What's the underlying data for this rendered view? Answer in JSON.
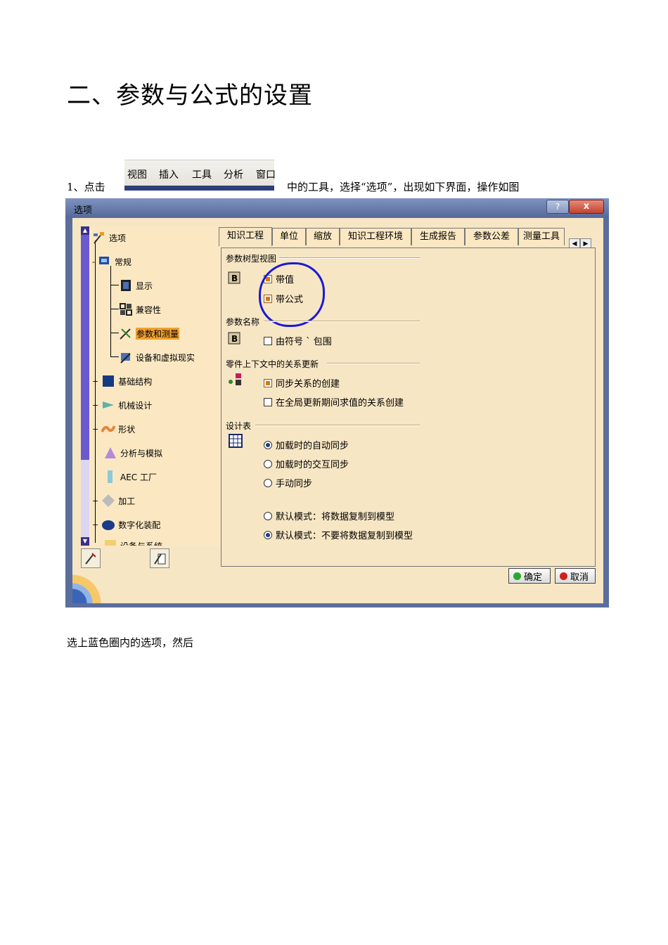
{
  "heading": "二、参数与公式的设置",
  "step": {
    "prefix": "1、点击",
    "suffix": "中的工具，选择“选项”，出现如下界面，操作如图",
    "menu_items": [
      "视图",
      "插入",
      "工具",
      "分析",
      "窗口"
    ]
  },
  "dialog": {
    "title": "选项",
    "help_label": "?",
    "close_label": "x",
    "tree": {
      "root": "选项",
      "items": [
        {
          "label": "常规",
          "expander": "-"
        },
        {
          "label": "显示"
        },
        {
          "label": "兼容性"
        },
        {
          "label": "参数和测量",
          "selected": true
        },
        {
          "label": "设备和虚拟现实"
        },
        {
          "label": "基础结构",
          "expander": "+"
        },
        {
          "label": "机械设计",
          "expander": "+"
        },
        {
          "label": "形状",
          "expander": "+"
        },
        {
          "label": "分析与模拟"
        },
        {
          "label": "AEC 工厂"
        },
        {
          "label": "加工",
          "expander": "+"
        },
        {
          "label": "数字化装配",
          "expander": "+"
        },
        {
          "label": "设备与系统"
        }
      ]
    },
    "tabs": [
      "知识工程",
      "单位",
      "缩放",
      "知识工程环境",
      "生成报告",
      "参数公差",
      "测量工具"
    ],
    "active_tab": "知识工程",
    "sections": {
      "tree_view": {
        "title": "参数树型视图",
        "options": [
          {
            "label": "带值",
            "checked": true
          },
          {
            "label": "带公式",
            "checked": true
          }
        ]
      },
      "param_name": {
        "title": "参数名称",
        "options": [
          {
            "label": "由符号 ` 包围",
            "checked": false
          }
        ]
      },
      "relations": {
        "title": "零件上下文中的关系更新",
        "options": [
          {
            "label": "同步关系的创建",
            "checked": true
          },
          {
            "label": "在全局更新期间求值的关系创建",
            "checked": false
          }
        ]
      },
      "design_table": {
        "title": "设计表",
        "radios": [
          {
            "label": "加载时的自动同步",
            "selected": true
          },
          {
            "label": "加载时的交互同步",
            "selected": false
          },
          {
            "label": "手动同步",
            "selected": false
          }
        ],
        "mode_radios": [
          {
            "label": "默认模式：将数据复制到模型",
            "selected": false
          },
          {
            "label": "默认模式：不要将数据复制到模型",
            "selected": true
          }
        ]
      }
    },
    "ok_label": "确定",
    "cancel_label": "取消"
  },
  "footer": "选上蓝色圈内的选项，然后",
  "colors": {
    "annotation_circle": "#1a1ad6",
    "selected_highlight": "#f0a030",
    "panel_bg": "#f7e6c4"
  }
}
